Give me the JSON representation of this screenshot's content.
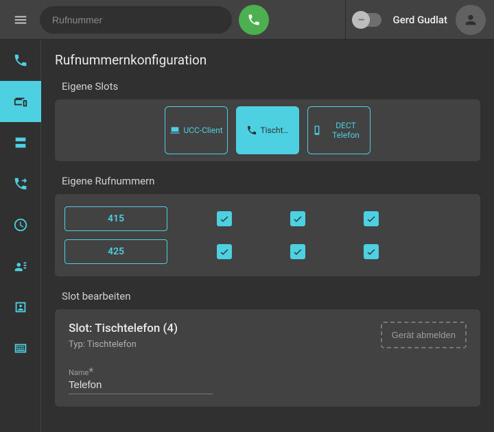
{
  "colors": {
    "accent": "#4dd0e1",
    "bg": "#303030",
    "panel": "#424242"
  },
  "topbar": {
    "search_placeholder": "Rufnummer",
    "username": "Gerd Gudlat"
  },
  "sidebar": {
    "items": [
      {
        "icon": "phone-icon",
        "active": false
      },
      {
        "icon": "devices-icon",
        "active": true
      },
      {
        "icon": "server-icon",
        "active": false
      },
      {
        "icon": "call-forward-icon",
        "active": false
      },
      {
        "icon": "clock-icon",
        "active": false
      },
      {
        "icon": "voice-icon",
        "active": false
      },
      {
        "icon": "contact-card-icon",
        "active": false
      },
      {
        "icon": "keypad-icon",
        "active": false
      }
    ]
  },
  "page": {
    "title": "Rufnummernkonfiguration",
    "own_slots_label": "Eigene Slots",
    "own_numbers_label": "Eigene Rufnummern",
    "edit_slot_label": "Slot bearbeiten"
  },
  "slots": [
    {
      "icon": "laptop-icon",
      "label": "UCC-Client",
      "active": false
    },
    {
      "icon": "phone-icon",
      "label": "Tischt…",
      "full_label": "Tischtelefon",
      "active": true
    },
    {
      "icon": "mobile-icon",
      "label": "DECT Telefon",
      "active": false
    }
  ],
  "numbers": [
    {
      "number": "415",
      "checks": [
        true,
        true,
        true
      ]
    },
    {
      "number": "425",
      "checks": [
        true,
        true,
        true
      ]
    }
  ],
  "edit_slot": {
    "title": "Slot: Tischtelefon (4)",
    "type_line": "Typ: Tischtelefon",
    "deregister_label": "Gerät abmelden",
    "name_field_label": "Name",
    "name_field_required_mark": "*",
    "name_field_value": "Telefon"
  }
}
